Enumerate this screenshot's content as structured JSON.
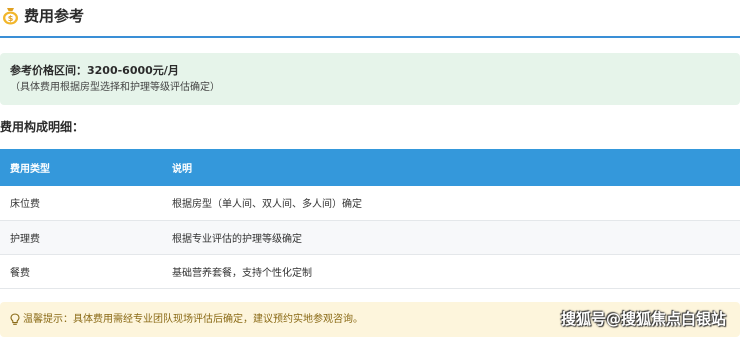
{
  "section": {
    "title": "费用参考",
    "icon": "money-bag-icon"
  },
  "price": {
    "range_line": "参考价格区间：3200-6000元/月",
    "note": "（具体费用根据房型选择和护理等级评估确定）"
  },
  "breakdown": {
    "heading": "费用构成明细：",
    "headers": [
      "费用类型",
      "说明"
    ],
    "rows": [
      {
        "type": "床位费",
        "desc": "根据房型（单人间、双人间、多人间）确定"
      },
      {
        "type": "护理费",
        "desc": "根据专业评估的护理等级确定"
      },
      {
        "type": "餐费",
        "desc": "基础营养套餐，支持个性化定制"
      }
    ]
  },
  "tip": {
    "icon": "lightbulb-icon",
    "text": "温馨提示：具体费用需经专业团队现场评估后确定，建议预约实地参观咨询。"
  },
  "watermark": "搜狐号@搜狐焦点白银站",
  "colors": {
    "accent": "#3498db",
    "price_bg": "#e6f4ea",
    "tip_bg": "#fdf5dc",
    "tip_text": "#8a6a16"
  }
}
